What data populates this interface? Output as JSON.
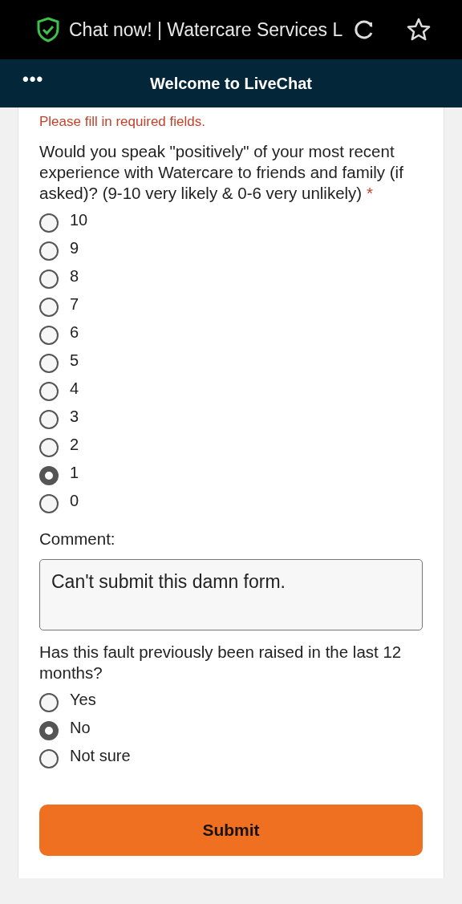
{
  "browser_bar": {
    "title": "Chat now! | Watercare Services L"
  },
  "header": {
    "menu": "•••",
    "title": "Welcome to LiveChat"
  },
  "form": {
    "error": "Please fill in required fields.",
    "questions": [
      {
        "kind": "radio",
        "text": "Would you speak \"positively\" of your most recent experience with Watercare to friends and family (if asked)? (9-10 very likely & 0-6 very unlikely)",
        "required_mark": "*",
        "options": [
          {
            "label": "10",
            "selected": false
          },
          {
            "label": "9",
            "selected": false
          },
          {
            "label": "8",
            "selected": false
          },
          {
            "label": "7",
            "selected": false
          },
          {
            "label": "6",
            "selected": false
          },
          {
            "label": "5",
            "selected": false
          },
          {
            "label": "4",
            "selected": false
          },
          {
            "label": "3",
            "selected": false
          },
          {
            "label": "2",
            "selected": false
          },
          {
            "label": "1",
            "selected": true
          },
          {
            "label": "0",
            "selected": false
          }
        ]
      },
      {
        "kind": "text",
        "text": "Comment:",
        "value": "Can't submit this damn form."
      },
      {
        "kind": "radio",
        "text": "Has this fault previously been raised in the last 12 months?",
        "options": [
          {
            "label": "Yes",
            "selected": false
          },
          {
            "label": "No",
            "selected": true
          },
          {
            "label": "Not sure",
            "selected": false
          }
        ]
      }
    ],
    "submit": "Submit"
  }
}
